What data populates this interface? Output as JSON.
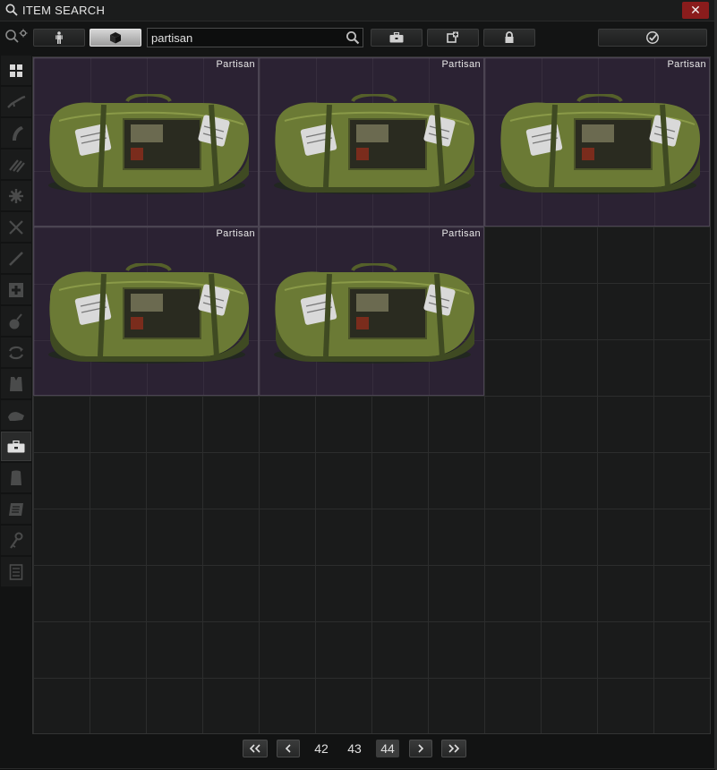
{
  "window": {
    "title": "ITEM SEARCH",
    "close_label": "✕"
  },
  "search": {
    "value": "partisan",
    "placeholder": ""
  },
  "toolbar": {
    "buttons": [
      {
        "icon": "character-icon",
        "active": false
      },
      {
        "icon": "box-icon",
        "active": true
      },
      {
        "icon": "briefcase-icon",
        "active": false
      },
      {
        "icon": "puzzle-icon",
        "active": false
      },
      {
        "icon": "lock-icon",
        "active": false
      },
      {
        "icon": "checkmark-icon",
        "active": false
      }
    ]
  },
  "sidebar": {
    "categories": [
      {
        "icon": "grid-icon",
        "selected": false
      },
      {
        "icon": "rifle-icon",
        "selected": false
      },
      {
        "icon": "magazine-icon",
        "selected": false
      },
      {
        "icon": "ammo-icon",
        "selected": false
      },
      {
        "icon": "barter-icon",
        "selected": false
      },
      {
        "icon": "melee-icon",
        "selected": false
      },
      {
        "icon": "knife-icon",
        "selected": false
      },
      {
        "icon": "medical-icon",
        "selected": false
      },
      {
        "icon": "grenade-icon",
        "selected": false
      },
      {
        "icon": "repair-icon",
        "selected": false
      },
      {
        "icon": "armor-icon",
        "selected": false
      },
      {
        "icon": "gear-rig-icon",
        "selected": false
      },
      {
        "icon": "container-icon",
        "selected": true
      },
      {
        "icon": "bag-icon",
        "selected": false
      },
      {
        "icon": "info-item-icon",
        "selected": false
      },
      {
        "icon": "key-icon",
        "selected": false
      },
      {
        "icon": "document-icon",
        "selected": false
      }
    ]
  },
  "items": [
    {
      "name": "Partisan"
    },
    {
      "name": "Partisan"
    },
    {
      "name": "Partisan"
    },
    {
      "name": "Partisan"
    },
    {
      "name": "Partisan"
    }
  ],
  "pagination": {
    "pages": [
      "42",
      "43",
      "44"
    ],
    "current": "44"
  },
  "colors": {
    "item_bg": "#2b2233",
    "close_bg": "#8a1c1c",
    "bag_green": "#6b7a35"
  }
}
